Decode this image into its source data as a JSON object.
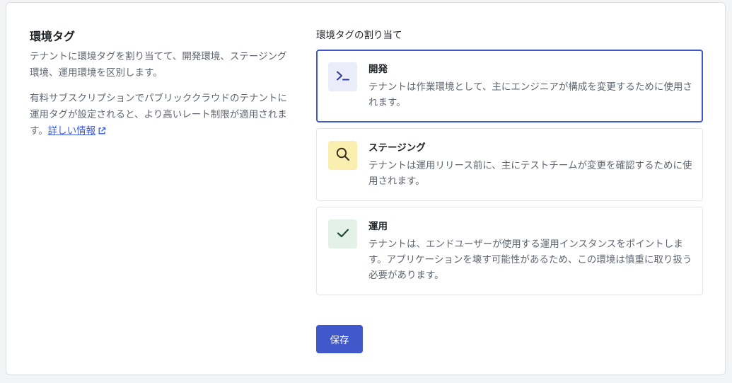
{
  "left": {
    "title": "環境タグ",
    "desc1": "テナントに環境タグを割り当てて、開発環境、ステージング環境、運用環境を区別します。",
    "desc2": "有料サブスクリプションでパブリッククラウドのテナントに運用タグが設定されると、より高いレート制限が適用されます。",
    "link_label": "詳しい情報"
  },
  "group": {
    "label": "環境タグの割り当て",
    "options": [
      {
        "title": "開発",
        "desc": "テナントは作業環境として、主にエンジニアが構成を変更するために使用されます。",
        "icon": "terminal-icon",
        "icon_bg": "#eaedf9",
        "selected": true
      },
      {
        "title": "ステージング",
        "desc": "テナントは運用リリース前に、主にテストチームが変更を確認するために使用されます。",
        "icon": "search-icon",
        "icon_bg": "#fbefb0",
        "selected": false
      },
      {
        "title": "運用",
        "desc": "テナントは、エンドユーザーが使用する運用インスタンスをポイントします。アプリケーションを壊す可能性があるため、この環境は慎重に取り扱う必要があります。",
        "icon": "check-icon",
        "icon_bg": "#e4f1e8",
        "selected": false
      }
    ]
  },
  "save_label": "保存",
  "colors": {
    "accent": "#4058c9",
    "link": "#3f5ad8",
    "muted_text": "#5f6670"
  }
}
